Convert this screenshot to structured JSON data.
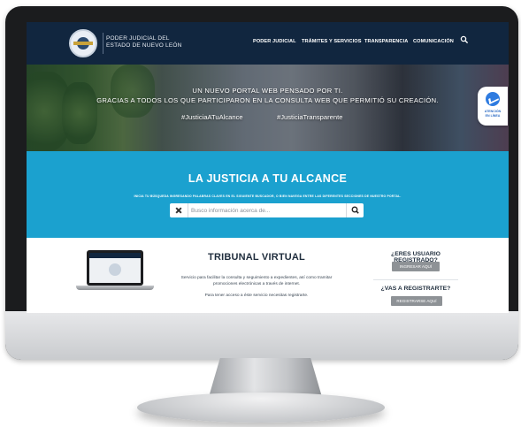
{
  "header": {
    "org_line1": "PODER JUDICIAL DEL",
    "org_line2": "ESTADO DE NUEVO LEÓN",
    "nav": [
      "PODER JUDICIAL",
      "TRÁMITES Y SERVICIOS",
      "TRANSPARENCIA",
      "COMUNICACIÓN"
    ],
    "search_icon": "search-icon"
  },
  "hero": {
    "line1": "UN NUEVO PORTAL WEB PENSADO POR TI.",
    "line2": "GRACIAS A TODOS LOS QUE PARTICIPARON EN LA CONSULTA WEB QUE PERMITIÓ SU CREACIÓN.",
    "hashtag1": "#JusticiaATuAlcance",
    "hashtag2": "#JusticiaTransparente",
    "chat_line1": "ATENCIÓN",
    "chat_line2": "EN LÍNEA",
    "chat_icon": "messenger-icon"
  },
  "search_band": {
    "title": "LA JUSTICIA A TU ALCANCE",
    "subtitle": "INICIA TU BÚSQUEDA INGRESANDO PALABRAS CLAVES EN EL SIGUIENTE BUSCADOR, O BIEN NAVEGA ENTRE LAS DIFERENTES SECCIONES DE NUESTRO PORTAL.",
    "placeholder": "Busco información acerca de...",
    "value": "",
    "bg_color": "#1ba1cf"
  },
  "tribunal": {
    "title": "TRIBUNAL VIRTUAL",
    "desc_line1": "Servicio para facilitar la consulta y seguimiento a expedientes, así como tramitar",
    "desc_line2": "promociones electrónicas a través de internet.",
    "note": "Para tener acceso a éste servicio necesitas registrarte.",
    "registered_q": "¿ERES USUARIO REGISTRADO?",
    "login_label": "INGRESAR AQUÍ",
    "register_q": "¿VAS A REGISTRARTE?",
    "register_label": "REGISTRARSE AQUÍ"
  },
  "colors": {
    "header_bg": "#11263f",
    "button_gray": "#8e9296"
  }
}
